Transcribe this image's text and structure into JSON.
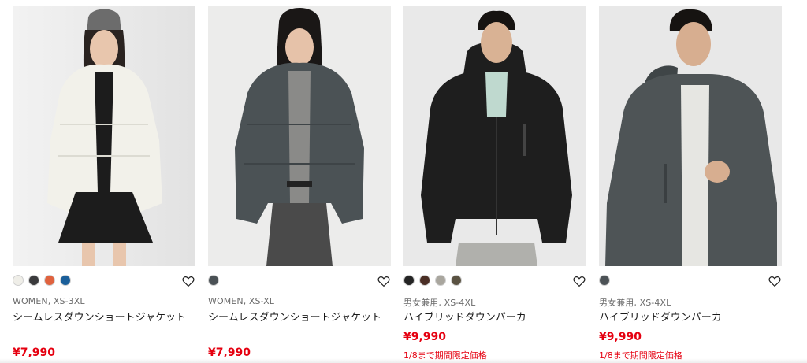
{
  "products": [
    {
      "meta": "WOMEN, XS-3XL",
      "name": "シームレスダウンショートジャケット",
      "price": "¥7,990",
      "promo": "",
      "swatches": [
        "#efeee8",
        "#3a3a3c",
        "#e0623e",
        "#1b5f9a"
      ],
      "photo": {
        "bg": "#eaeaea",
        "garment": "#f2f1ea",
        "inner": "#1c1c1c",
        "hair": "#2a2320",
        "hat": "#6c6c6c",
        "skin": "#e8c6ad"
      },
      "swatch_labels": [
        "off-white",
        "dark gray",
        "orange",
        "blue"
      ]
    },
    {
      "meta": "WOMEN, XS-XL",
      "name": "シームレスダウンショートジャケット",
      "price": "¥7,990",
      "promo": "",
      "swatches": [
        "#4a5155"
      ],
      "photo": {
        "bg": "#ececeb",
        "garment": "#4b5255",
        "inner": "#8a8a88",
        "hair": "#1a1716",
        "hat": "#1a1716",
        "skin": "#e6c2a9"
      },
      "swatch_labels": [
        "gray"
      ]
    },
    {
      "meta": "男女兼用, XS-4XL",
      "name": "ハイブリッドダウンパーカ",
      "price": "¥9,990",
      "promo": "1/8まで期間限定価格",
      "swatches": [
        "#242424",
        "#4a2e25",
        "#a9a69e",
        "#5a5242"
      ],
      "photo": {
        "bg": "#e9e9e9",
        "garment": "#1e1e1e",
        "inner": "#bfd9cf",
        "hair": "#161311",
        "hat": "#161311",
        "skin": "#d9b294"
      },
      "swatch_labels": [
        "black",
        "brown",
        "light gray",
        "olive"
      ]
    },
    {
      "meta": "男女兼用, XS-4XL",
      "name": "ハイブリッドダウンパーカ",
      "price": "¥9,990",
      "promo": "1/8まで期間限定価格",
      "swatches": [
        "#4c5256"
      ],
      "photo": {
        "bg": "#e8e8e8",
        "garment": "#4e5456",
        "inner": "#e6e6e2",
        "hair": "#161311",
        "hat": "#161311",
        "skin": "#d7ae90"
      },
      "swatch_labels": [
        "gray"
      ]
    }
  ],
  "icons": {
    "favorite": "heart-outline-icon"
  }
}
